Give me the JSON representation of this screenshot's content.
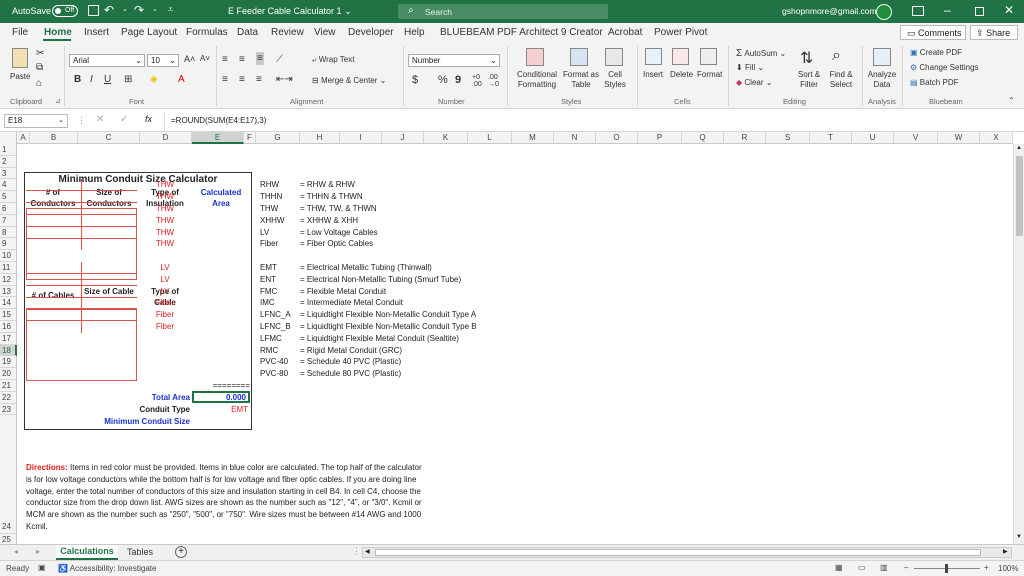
{
  "titlebar": {
    "autosave_label": "AutoSave",
    "autosave_state": "Off",
    "doc_title": "E Feeder Cable Calculator 1",
    "search_placeholder": "Search",
    "user_email": "gshopnmore@gmail.com"
  },
  "menu": [
    "File",
    "Home",
    "Insert",
    "Page Layout",
    "Formulas",
    "Data",
    "Review",
    "View",
    "Developer",
    "Help",
    "BLUEBEAM",
    "PDF Architect 9 Creator",
    "Acrobat",
    "Power Pivot"
  ],
  "menu_active": "Home",
  "menu_right": {
    "comments": "Comments",
    "share": "Share"
  },
  "ribbon": {
    "clipboard": {
      "paste": "Paste",
      "label": "Clipboard"
    },
    "font": {
      "family": "Arial",
      "size": "10",
      "bold": "B",
      "italic": "I",
      "underline": "U",
      "label": "Font"
    },
    "alignment": {
      "wrap": "Wrap Text",
      "merge": "Merge & Center",
      "label": "Alignment"
    },
    "number": {
      "format": "Number",
      "currency": "$",
      "percent": "%",
      "comma": "9",
      "label": "Number"
    },
    "styles": {
      "conditional": "Conditional Formatting",
      "format_table": "Format as Table",
      "cell_styles": "Cell Styles",
      "label": "Styles"
    },
    "cells": {
      "insert": "Insert",
      "delete": "Delete",
      "format": "Format",
      "label": "Cells"
    },
    "editing": {
      "autosum": "AutoSum",
      "fill": "Fill",
      "clear": "Clear",
      "sort": "Sort & Filter",
      "find": "Find & Select",
      "label": "Editing"
    },
    "analysis": {
      "analyze": "Analyze Data",
      "label": "Analysis"
    },
    "bluebeam": {
      "create": "Create PDF",
      "change": "Change Settings",
      "batch": "Batch PDF",
      "label": "Bluebeam"
    }
  },
  "formula_bar": {
    "name_box": "E18",
    "fx": "fx",
    "formula": "=ROUND(SUM(E4:E17),3)"
  },
  "columns": [
    "A",
    "B",
    "C",
    "D",
    "E",
    "F",
    "G",
    "H",
    "I",
    "J",
    "K",
    "L",
    "M",
    "N",
    "O",
    "P",
    "Q",
    "R",
    "S",
    "T",
    "U",
    "V",
    "W",
    "X"
  ],
  "rows": [
    "1",
    "2",
    "3",
    "4",
    "5",
    "6",
    "7",
    "8",
    "9",
    "10",
    "11",
    "12",
    "13",
    "14",
    "15",
    "16",
    "17",
    "18",
    "19",
    "20",
    "21",
    "22",
    "23",
    "24",
    "25"
  ],
  "calculator": {
    "title": "Minimum Conduit Size Calculator",
    "hdr_num_conductors": "# of Conductors",
    "hdr_size_conductors": "Size of Conductors",
    "hdr_type_insulation": "Type of Insulation",
    "hdr_calc_area": "Calculated Area",
    "insulation": [
      "THW",
      "THW",
      "THW",
      "THW",
      "THW",
      "THW"
    ],
    "hdr_num_cables": "# of Cables",
    "hdr_size_cable": "Size of Cable",
    "hdr_type_cable": "Type of Cable",
    "cable_types": [
      "LV",
      "LV",
      "LV",
      "Fiber",
      "Fiber",
      "Fiber"
    ],
    "separator": "========",
    "total_area_label": "Total Area",
    "total_area_value": "0.000",
    "conduit_type_label": "Conduit Type",
    "conduit_type_value": "EMT",
    "min_conduit_label": "Minimum Conduit Size"
  },
  "legend_insulation": [
    {
      "code": "RHW",
      "desc": "= RHW & RHW"
    },
    {
      "code": "THHN",
      "desc": "= THHN & THWN"
    },
    {
      "code": "THW",
      "desc": "= THW, TW, & THWN"
    },
    {
      "code": "XHHW",
      "desc": "= XHHW & XHH"
    },
    {
      "code": "LV",
      "desc": "= Low Voltage Cables"
    },
    {
      "code": "Fiber",
      "desc": "= Fiber Optic Cables"
    }
  ],
  "legend_conduit": [
    {
      "code": "EMT",
      "desc": "= Electrical Metallic Tubing (Thinwall)"
    },
    {
      "code": "ENT",
      "desc": "= Electrical Non-Metallic Tubing (Smurf Tube)"
    },
    {
      "code": "FMC",
      "desc": "= Flexible Metal Conduit"
    },
    {
      "code": "IMC",
      "desc": "= Intermediate Metal Conduit"
    },
    {
      "code": "LFNC_A",
      "desc": "= Liquidtight Flexible Non-Metallic Conduit Type A"
    },
    {
      "code": "LFNC_B",
      "desc": "= Liquidtight Flexible Non-Metallic Conduit Type B"
    },
    {
      "code": "LFMC",
      "desc": "= Liquidtight Flexible Metal Conduit (Sealtite)"
    },
    {
      "code": "RMC",
      "desc": "= Rigid Metal Conduit (GRC)"
    },
    {
      "code": "PVC-40",
      "desc": "= Schedule 40 PVC (Plastic)"
    },
    {
      "code": "PVC-80",
      "desc": "= Schedule 80 PVC (Plastic)"
    }
  ],
  "directions": {
    "label": "Directions:",
    "lines": [
      " Items in red color must be provided. Items in blue color are calculated. The top half of the calculator",
      "is for low voltage conductors while the bottom half is for low voltage and fiber optic cables. If you are doing line",
      "voltage, enter the total number of conductors of this size and insulation starting in cell B4. In cell C4, choose the",
      "conductor size from the drop down list. AWG sizes are shown as the number such as \"12\", \"4\", or \"3/0\". Kcmil or",
      "MCM are shown as the number such as \"250\", \"500\", or \"750\". Wire sizes must be between #14 AWG and 1000",
      "Kcmil."
    ]
  },
  "sheet_tabs": [
    "Calculations",
    "Tables"
  ],
  "active_tab": "Calculations",
  "status": {
    "ready": "Ready",
    "accessibility": "Accessibility: Investigate",
    "zoom": "100%"
  },
  "colors": {
    "accent": "#217346",
    "required": "#e02020",
    "calculated": "#1a2fd0"
  }
}
